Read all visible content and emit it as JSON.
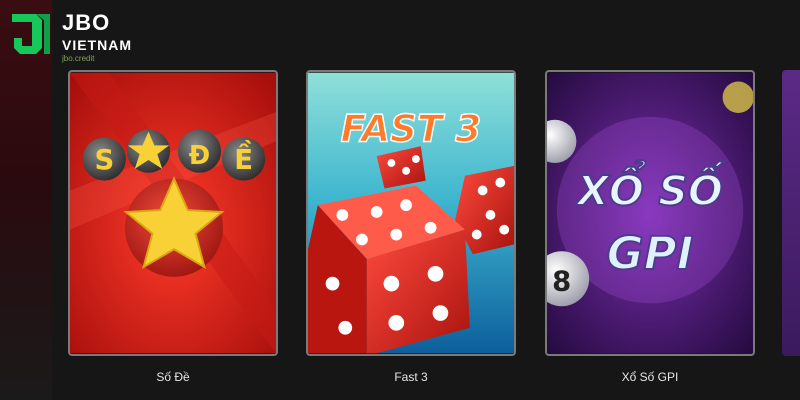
{
  "brand": {
    "name": "JBO",
    "country": "VIETNAM",
    "domain": "jbo.credit",
    "accent": "#16c75a"
  },
  "games": [
    {
      "title": "Số Đề",
      "art_text": "SỐ ĐỀ",
      "color": "#d8201a"
    },
    {
      "title": "Fast 3",
      "art_text": "FAST 3",
      "color": "#2aa7c9"
    },
    {
      "title": "Xổ Số GPI",
      "art_text_1": "XỔ SỐ",
      "art_text_2": "GPI",
      "color": "#3a1466"
    }
  ]
}
